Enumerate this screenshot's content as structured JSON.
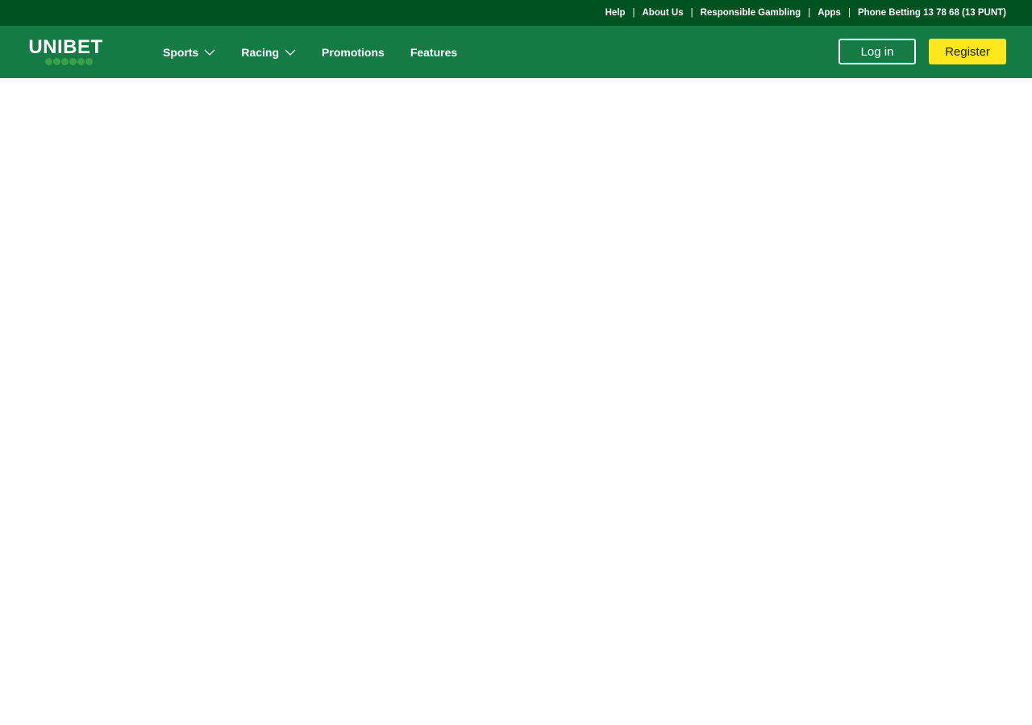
{
  "utility_nav": {
    "links": [
      "Help",
      "About Us",
      "Responsible Gambling",
      "Apps",
      "Phone Betting 13 78 68 (13 PUNT)"
    ],
    "separator": "|"
  },
  "brand": {
    "name": "UNIBET",
    "dot_colors": [
      "#3aa049",
      "#3aa049",
      "#3aa049",
      "#3aa049",
      "#3aa049",
      "#3aa049"
    ]
  },
  "main_nav": {
    "items": [
      {
        "label": "Sports",
        "has_dropdown": true,
        "icon": "chevron-down-icon"
      },
      {
        "label": "Racing",
        "has_dropdown": true,
        "icon": "chevron-down-icon"
      },
      {
        "label": "Promotions",
        "has_dropdown": false
      },
      {
        "label": "Features",
        "has_dropdown": false
      }
    ]
  },
  "actions": {
    "login_label": "Log in",
    "register_label": "Register"
  },
  "colors": {
    "utility_bar": "#005221",
    "header": "#147b45",
    "register_bg": "#ffe71f",
    "page_bg": "#ffffff"
  }
}
